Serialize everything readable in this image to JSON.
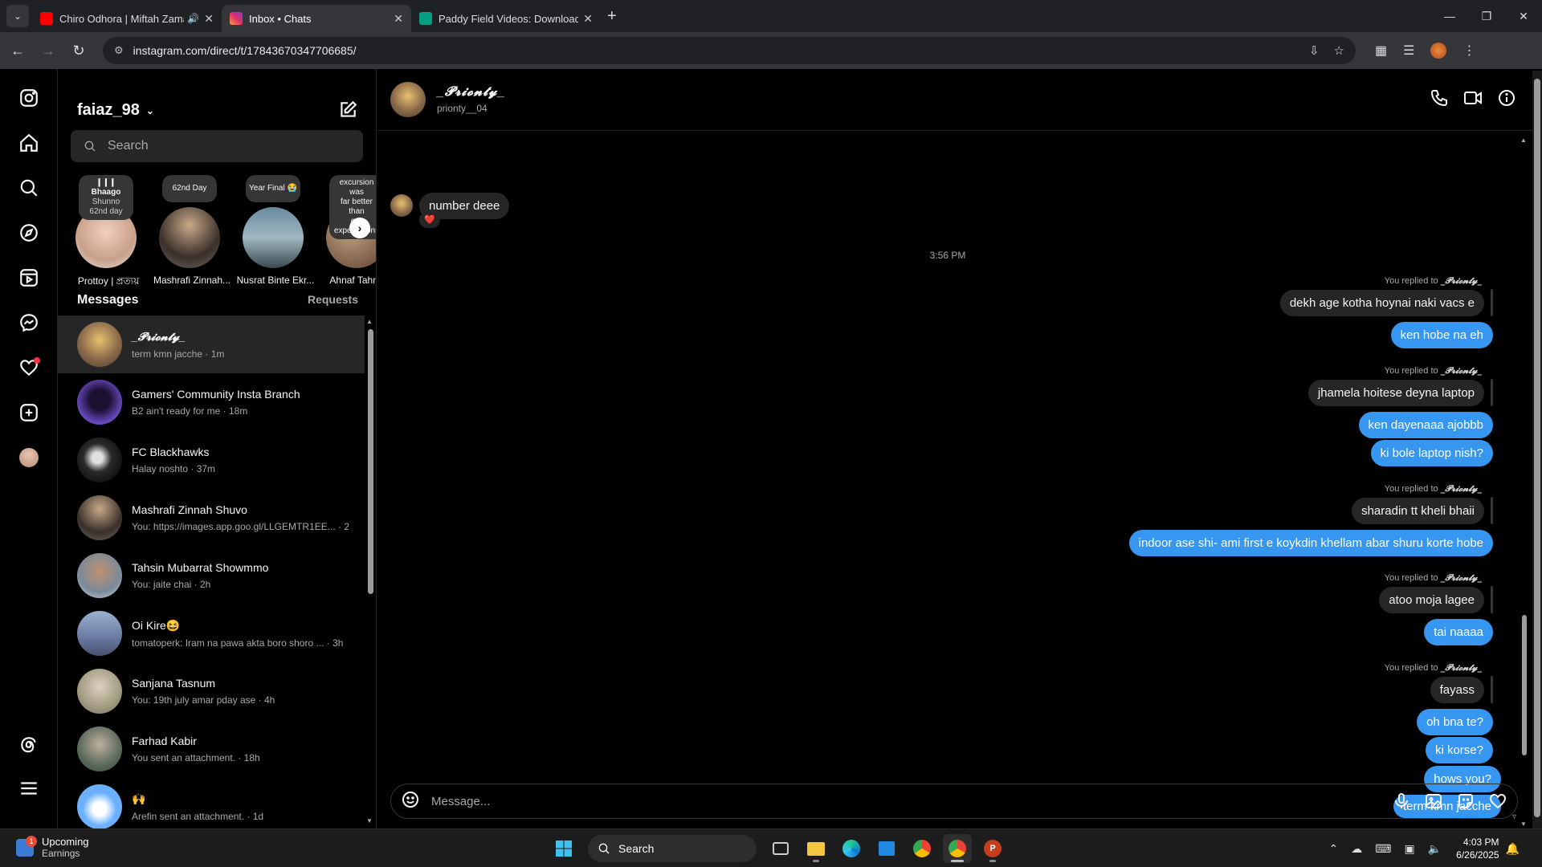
{
  "browser": {
    "tabs": [
      {
        "title": "Chiro Odhora | Miftah Zaman",
        "active": false,
        "favicon_color": "#ff0000",
        "audio": true
      },
      {
        "title": "Inbox • Chats",
        "active": true,
        "favicon_color": "#e1306c",
        "audio": false
      },
      {
        "title": "Paddy Field Videos: Download 10",
        "active": false,
        "favicon_color": "#05a081",
        "audio": false
      }
    ],
    "url": "instagram.com/direct/t/17843670347706685/"
  },
  "inbox": {
    "username": "faiaz_98",
    "search_placeholder": "Search",
    "notes": [
      {
        "line1": "❙❙❙ Bhaago",
        "line2": "Shunno",
        "line3": "62nd day",
        "name": "Prottoy | প্রত্যয়"
      },
      {
        "line1": "62nd Day",
        "line2": "",
        "line3": "",
        "name": "Mashrafi Zinnah..."
      },
      {
        "line1": "Year Final 😭",
        "line2": "",
        "line3": "",
        "name": "Nusrat Binte Ekr..."
      },
      {
        "line1": "excursion was",
        "line2": "far better than",
        "line3": "our expectations",
        "name": "Ahnaf Tahmid"
      }
    ],
    "messages_label": "Messages",
    "requests_label": "Requests",
    "threads": [
      {
        "name": "_𝓟𝓻𝓲𝓸𝓷𝓽𝔂_",
        "sub": "term kmn jacche · 1m",
        "color": "#8a6a4a",
        "selected": true
      },
      {
        "name": "Gamers' Community Insta Branch",
        "sub": "B2 ain't ready for me · 18m",
        "color": "#3a2a6a",
        "selected": false
      },
      {
        "name": "FC Blackhawks",
        "sub": "Halay noshto · 37m",
        "color": "#1a1a1a",
        "selected": false
      },
      {
        "name": "Mashrafi Zinnah Shuvo",
        "sub": "You: https://images.app.goo.gl/LLGEMTR1EE... · 2h",
        "color": "#5b4a3a",
        "selected": false
      },
      {
        "name": "Tahsin Mubarrat Showmmo",
        "sub": "You: jaite chai · 2h",
        "color": "#7a8a9a",
        "selected": false
      },
      {
        "name": "Oi Kire😆",
        "sub": "tomatoperk: Iram na pawa akta boro shoro ... · 3h",
        "color": "#6a7aa0",
        "selected": false
      },
      {
        "name": "Sanjana Tasnum",
        "sub": "You: 19th july amar pday ase · 4h",
        "color": "#a09a80",
        "selected": false
      },
      {
        "name": "Farhad Kabir",
        "sub": "You sent an attachment. · 18h",
        "color": "#5a6a5a",
        "selected": false
      },
      {
        "name": "🙌",
        "sub": "Arefin sent an attachment. · 1d",
        "color": "#6ab0ff",
        "selected": false
      }
    ]
  },
  "chat": {
    "name": "_𝓟𝓻𝓲𝓸𝓷𝓽𝔂_",
    "handle": "prionty__04",
    "first_message": "number deee",
    "first_reaction": "❤️",
    "timestamp": "3:56 PM",
    "reply_prefix": "You replied to",
    "reply_name": "_𝓟𝓻𝓲𝓸𝓷𝓽𝔂_",
    "quoted": [
      "dekh age kotha hoynai naki vacs e",
      "jhamela hoitese deyna laptop",
      "sharadin tt kheli bhaii",
      "atoo moja lagee",
      "fayass"
    ],
    "sent": [
      "ken hobe na eh",
      "ken dayenaaa ajobbb",
      "ki bole laptop nish?",
      "indoor ase shi- ami first e koykdin khellam abar shuru korte hobe",
      "tai naaaa",
      "oh bna te?",
      "ki korse?",
      "hows you?",
      "term kmn jacche"
    ],
    "composer_placeholder": "Message..."
  },
  "taskbar": {
    "widget_title": "Upcoming",
    "widget_sub": "Earnings",
    "widget_badge": "1",
    "search_label": "Search",
    "time": "4:03 PM",
    "date": "6/26/2025"
  }
}
